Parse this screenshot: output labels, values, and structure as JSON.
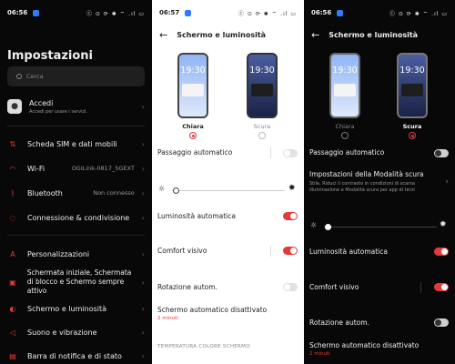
{
  "colors": {
    "accent": "#e23b3b",
    "dark_bg": "#080808",
    "light_bg": "#ffffff"
  },
  "panel1": {
    "status": {
      "time": "06:56",
      "icons": "ⓒ ⊙ ⟳ ✱ ⌔ .ıl ▭"
    },
    "title": "Impostazioni",
    "search_placeholder": "Cerca",
    "account": {
      "label": "Accedi",
      "sub": "Accedi per usare i servizi."
    },
    "items": [
      {
        "label": "Scheda SIM e dati mobili",
        "value": "",
        "icon": "sim-icon"
      },
      {
        "label": "Wi-Fi",
        "value": "OGILink-0817_5GEXT",
        "icon": "wifi-icon"
      },
      {
        "label": "Bluetooth",
        "value": "Non connesso",
        "icon": "bluetooth-icon"
      },
      {
        "label": "Connessione & condivisione",
        "value": "",
        "icon": "connection-icon"
      },
      {
        "label": "Personalizzazioni",
        "value": "",
        "icon": "personalization-icon"
      },
      {
        "label": "Schermata iniziale, Schermata di blocco e Schermo sempre attivo",
        "value": "",
        "icon": "home-screen-icon"
      },
      {
        "label": "Schermo e luminosità",
        "value": "",
        "icon": "display-icon"
      },
      {
        "label": "Suono e vibrazione",
        "value": "",
        "icon": "sound-icon"
      },
      {
        "label": "Barra di notifica e di stato",
        "value": "",
        "icon": "notification-icon"
      }
    ]
  },
  "panel2": {
    "status": {
      "time": "06:57",
      "icons": "ⓒ ⊙ ⟳ ✱ ⌔ .ıl ▭"
    },
    "header": "Schermo e luminosità",
    "mode_light": {
      "clock": "19:30",
      "label": "Chiara",
      "selected": true
    },
    "mode_dark": {
      "clock": "19:30",
      "label": "Scura",
      "selected": false
    },
    "auto_switch": "Passaggio automatico",
    "auto_brightness": "Luminosità automatica",
    "visual_comfort": "Comfort visivo",
    "auto_rotate": "Rotazione autom.",
    "screen_off": {
      "label": "Schermo automatico disattivato",
      "value": "2 minuti"
    },
    "section": "TEMPERATURA COLORE SCHERMO"
  },
  "panel3": {
    "status": {
      "time": "06:56",
      "icons": "ⓒ ⊙ ⟳ ✱ ⌔ .ıl ▭"
    },
    "header": "Schermo e luminosità",
    "mode_light": {
      "clock": "19:30",
      "label": "Chiara",
      "selected": false
    },
    "mode_dark": {
      "clock": "19:30",
      "label": "Scura",
      "selected": true
    },
    "auto_switch": "Passaggio automatico",
    "dark_settings": {
      "label": "Impostazioni della Modalità scura",
      "sub": "Stile, Riduci il contrasto in condizioni di scarsa illuminazione e Modalità scura per app di terzi"
    },
    "auto_brightness": "Luminosità automatica",
    "visual_comfort": "Comfort visivo",
    "auto_rotate": "Rotazione autom.",
    "screen_off": {
      "label": "Schermo automatico disattivato",
      "value": "2 minuti"
    }
  }
}
